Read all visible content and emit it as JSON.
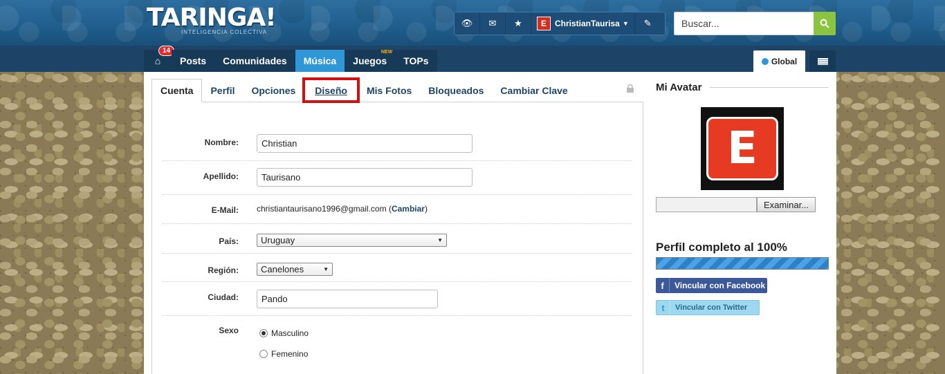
{
  "header": {
    "logo": "TARINGA!",
    "logo_sub": "INTELIGENCIA COLECTIVA",
    "username": "ChristianTaurisa",
    "avatar_letter": "E",
    "search_placeholder": "Buscar..."
  },
  "nav": {
    "badge_count": "14",
    "items": [
      {
        "label": "Posts"
      },
      {
        "label": "Comunidades"
      },
      {
        "label": "Música"
      },
      {
        "label": "Juegos",
        "tag": "NEW"
      },
      {
        "label": "TOPs"
      }
    ],
    "global_label": "Global"
  },
  "tabs": [
    {
      "label": "Cuenta"
    },
    {
      "label": "Perfil"
    },
    {
      "label": "Opciones"
    },
    {
      "label": "Diseño"
    },
    {
      "label": "Mis Fotos"
    },
    {
      "label": "Bloqueados"
    },
    {
      "label": "Cambiar Clave"
    }
  ],
  "form": {
    "nombre_label": "Nombre:",
    "nombre_value": "Christian",
    "apellido_label": "Apellido:",
    "apellido_value": "Taurisano",
    "email_label": "E-Mail:",
    "email_value": "christiantaurisano1996@gmail.com",
    "email_link": "Cambiar",
    "pais_label": "País:",
    "pais_value": "Uruguay",
    "region_label": "Región:",
    "region_value": "Canelones",
    "ciudad_label": "Ciudad:",
    "ciudad_value": "Pando",
    "sexo_label": "Sexo",
    "sexo_options": [
      "Masculino",
      "Femenino"
    ],
    "sexo_selected": "Masculino"
  },
  "sidebar": {
    "avatar_title": "Mi Avatar",
    "browse_button": "Examinar...",
    "complete_title": "Perfil completo al 100%",
    "complete_progress": 1.0,
    "facebook_button": "Vincular con Facebook",
    "twitter_button": "Vincular con Twitter"
  },
  "colors": {
    "accent": "#2f97d8",
    "nav_bg": "#1d4466",
    "highlight": "#d30f0f",
    "facebook": "#3b5998",
    "twitter": "#9ed8f0"
  }
}
